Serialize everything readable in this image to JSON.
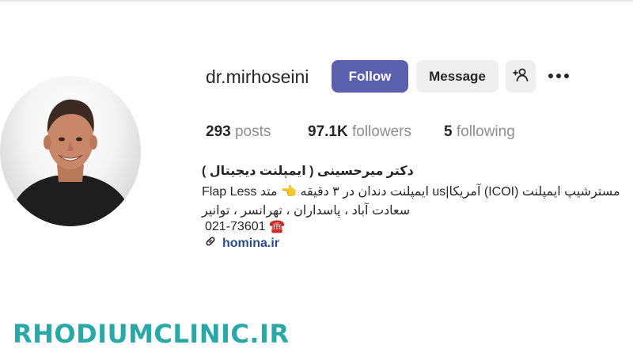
{
  "profile": {
    "username": "dr.mirhoseini",
    "follow_label": "Follow",
    "message_label": "Message",
    "suggest_icon": "add-person-icon",
    "more_icon": "more-options-icon"
  },
  "stats": {
    "posts_count": "293",
    "posts_label": "posts",
    "followers_count": "97.1K",
    "followers_label": "followers",
    "following_count": "5",
    "following_label": "following"
  },
  "bio": {
    "name": "دکتر میرحسینی ( ایمپلنت دیجیتال )",
    "line1_rtl": "مسترشیپ ایمپلنت (ICOI) آمریکا|us ایمپلنت دندان در ۳ دقیقه 👈 متد",
    "line1_ltr": "Flap Less",
    "line2": "سعادت آباد ، پاسداران ، تهرانسر ، توانیر",
    "phone": "021-73601",
    "phone_icon": "telephone-icon",
    "link": "homina.ir",
    "link_icon": "link-icon"
  },
  "watermark": "RHODIUMCLINIC.IR",
  "colors": {
    "follow_button": "#5a5fae",
    "secondary_button": "#efefef",
    "link": "#2a4c8c",
    "watermark": "#2aa8a8"
  }
}
